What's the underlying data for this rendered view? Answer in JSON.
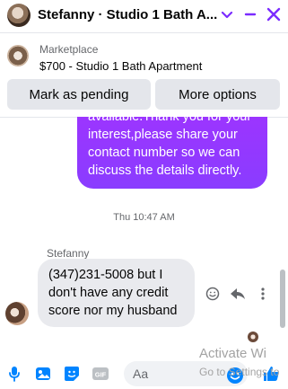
{
  "header": {
    "title": "Stefanny · Studio 1 Bath A...",
    "icons": [
      "chevron-down-icon",
      "minimize-icon",
      "close-icon"
    ]
  },
  "marketplace": {
    "label": "Marketplace",
    "listing": "$700 - Studio 1 Bath Apartment",
    "buttons": {
      "pending": "Mark as pending",
      "more": "More options"
    }
  },
  "messages": {
    "outgoing_text": "available.Thank you for your interest,please share your contact number so we can discuss the details directly.",
    "timestamp": "Thu 10:47 AM",
    "sender_name": "Stefanny",
    "incoming_text": "(347)231-5008 but I don't have any credit score nor my husband"
  },
  "composer": {
    "placeholder": "Aa",
    "icons": [
      "mic-icon",
      "photo-icon",
      "sticker-icon",
      "gif-icon",
      "emoji-icon",
      "like-icon"
    ],
    "gif_label": "GIF"
  },
  "watermark": {
    "line1": "Activate Wi",
    "line2": "Go to Settings to"
  },
  "colors": {
    "accent": "#0084ff",
    "close": "#7b2cff",
    "outgoing_bubble": "#9a35ff",
    "incoming_bubble": "#e9eaee"
  }
}
